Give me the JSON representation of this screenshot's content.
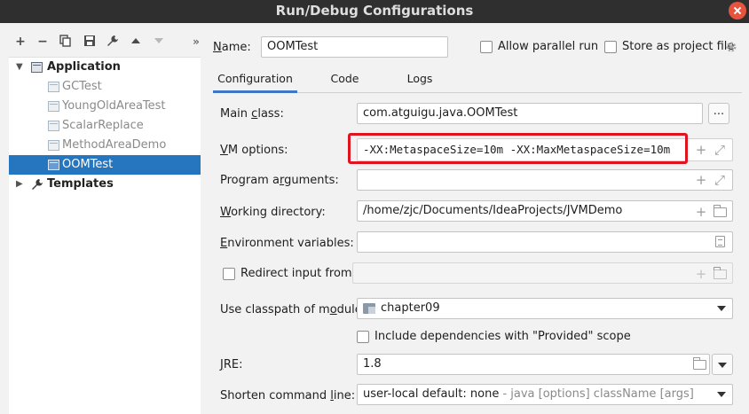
{
  "window": {
    "title": "Run/Debug Configurations"
  },
  "tree": {
    "application": {
      "label": "Application",
      "items": [
        "GCTest",
        "YoungOldAreaTest",
        "ScalarReplace",
        "MethodAreaDemo",
        "OOMTest"
      ],
      "selected": "OOMTest"
    },
    "templates": {
      "label": "Templates"
    }
  },
  "header": {
    "name_label": "Name:",
    "name_value": "OOMTest",
    "allow_parallel_label": "Allow parallel run",
    "store_as_file_label": "Store as project file"
  },
  "tabs": [
    "Configuration",
    "Code Coverage",
    "Logs"
  ],
  "form": {
    "main_class": {
      "label": "Main class:",
      "value": "com.atguigu.java.OOMTest",
      "button": "..."
    },
    "vm_options": {
      "label": "VM options:",
      "value": "-XX:MetaspaceSize=10m -XX:MaxMetaspaceSize=10m"
    },
    "program_arguments": {
      "label": "Program arguments:",
      "value": ""
    },
    "working_directory": {
      "label": "Working directory:",
      "value": "/home/zjc/Documents/IdeaProjects/JVMDemo"
    },
    "environment_variables": {
      "label": "Environment variables:",
      "value": ""
    },
    "redirect_input": {
      "label": "Redirect input from:",
      "value": ""
    },
    "classpath_module": {
      "label": "Use classpath of module:",
      "value": "chapter09"
    },
    "include_provided": {
      "label": "Include dependencies with \"Provided\" scope"
    },
    "jre": {
      "label": "JRE:",
      "value": "1.8"
    },
    "shorten_command_line": {
      "label": "Shorten command line:",
      "value_main": "user-local default: none",
      "value_hint": " - java [options] className [args]"
    }
  },
  "colors": {
    "selection": "#2675bf",
    "highlight_box": "#e0141e",
    "title_bar": "#2f2f2f",
    "active_tab": "#3d78c2"
  },
  "icons": [
    "plus-icon",
    "minus-icon",
    "copy-icon",
    "save-icon",
    "wrench-icon",
    "move-up-icon",
    "move-down-icon",
    "expand-icon",
    "application-icon",
    "gear-icon",
    "expand-field-icon",
    "folder-icon",
    "notes-icon",
    "module-icon",
    "chevron-down-icon",
    "close-icon"
  ]
}
